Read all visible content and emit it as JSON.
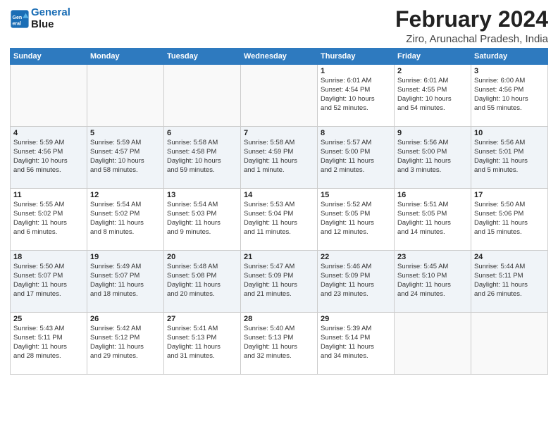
{
  "header": {
    "logo_line1": "General",
    "logo_line2": "Blue",
    "month_year": "February 2024",
    "location": "Ziro, Arunachal Pradesh, India"
  },
  "weekdays": [
    "Sunday",
    "Monday",
    "Tuesday",
    "Wednesday",
    "Thursday",
    "Friday",
    "Saturday"
  ],
  "weeks": [
    [
      {
        "day": "",
        "info": ""
      },
      {
        "day": "",
        "info": ""
      },
      {
        "day": "",
        "info": ""
      },
      {
        "day": "",
        "info": ""
      },
      {
        "day": "1",
        "info": "Sunrise: 6:01 AM\nSunset: 4:54 PM\nDaylight: 10 hours\nand 52 minutes."
      },
      {
        "day": "2",
        "info": "Sunrise: 6:01 AM\nSunset: 4:55 PM\nDaylight: 10 hours\nand 54 minutes."
      },
      {
        "day": "3",
        "info": "Sunrise: 6:00 AM\nSunset: 4:56 PM\nDaylight: 10 hours\nand 55 minutes."
      }
    ],
    [
      {
        "day": "4",
        "info": "Sunrise: 5:59 AM\nSunset: 4:56 PM\nDaylight: 10 hours\nand 56 minutes."
      },
      {
        "day": "5",
        "info": "Sunrise: 5:59 AM\nSunset: 4:57 PM\nDaylight: 10 hours\nand 58 minutes."
      },
      {
        "day": "6",
        "info": "Sunrise: 5:58 AM\nSunset: 4:58 PM\nDaylight: 10 hours\nand 59 minutes."
      },
      {
        "day": "7",
        "info": "Sunrise: 5:58 AM\nSunset: 4:59 PM\nDaylight: 11 hours\nand 1 minute."
      },
      {
        "day": "8",
        "info": "Sunrise: 5:57 AM\nSunset: 5:00 PM\nDaylight: 11 hours\nand 2 minutes."
      },
      {
        "day": "9",
        "info": "Sunrise: 5:56 AM\nSunset: 5:00 PM\nDaylight: 11 hours\nand 3 minutes."
      },
      {
        "day": "10",
        "info": "Sunrise: 5:56 AM\nSunset: 5:01 PM\nDaylight: 11 hours\nand 5 minutes."
      }
    ],
    [
      {
        "day": "11",
        "info": "Sunrise: 5:55 AM\nSunset: 5:02 PM\nDaylight: 11 hours\nand 6 minutes."
      },
      {
        "day": "12",
        "info": "Sunrise: 5:54 AM\nSunset: 5:02 PM\nDaylight: 11 hours\nand 8 minutes."
      },
      {
        "day": "13",
        "info": "Sunrise: 5:54 AM\nSunset: 5:03 PM\nDaylight: 11 hours\nand 9 minutes."
      },
      {
        "day": "14",
        "info": "Sunrise: 5:53 AM\nSunset: 5:04 PM\nDaylight: 11 hours\nand 11 minutes."
      },
      {
        "day": "15",
        "info": "Sunrise: 5:52 AM\nSunset: 5:05 PM\nDaylight: 11 hours\nand 12 minutes."
      },
      {
        "day": "16",
        "info": "Sunrise: 5:51 AM\nSunset: 5:05 PM\nDaylight: 11 hours\nand 14 minutes."
      },
      {
        "day": "17",
        "info": "Sunrise: 5:50 AM\nSunset: 5:06 PM\nDaylight: 11 hours\nand 15 minutes."
      }
    ],
    [
      {
        "day": "18",
        "info": "Sunrise: 5:50 AM\nSunset: 5:07 PM\nDaylight: 11 hours\nand 17 minutes."
      },
      {
        "day": "19",
        "info": "Sunrise: 5:49 AM\nSunset: 5:07 PM\nDaylight: 11 hours\nand 18 minutes."
      },
      {
        "day": "20",
        "info": "Sunrise: 5:48 AM\nSunset: 5:08 PM\nDaylight: 11 hours\nand 20 minutes."
      },
      {
        "day": "21",
        "info": "Sunrise: 5:47 AM\nSunset: 5:09 PM\nDaylight: 11 hours\nand 21 minutes."
      },
      {
        "day": "22",
        "info": "Sunrise: 5:46 AM\nSunset: 5:09 PM\nDaylight: 11 hours\nand 23 minutes."
      },
      {
        "day": "23",
        "info": "Sunrise: 5:45 AM\nSunset: 5:10 PM\nDaylight: 11 hours\nand 24 minutes."
      },
      {
        "day": "24",
        "info": "Sunrise: 5:44 AM\nSunset: 5:11 PM\nDaylight: 11 hours\nand 26 minutes."
      }
    ],
    [
      {
        "day": "25",
        "info": "Sunrise: 5:43 AM\nSunset: 5:11 PM\nDaylight: 11 hours\nand 28 minutes."
      },
      {
        "day": "26",
        "info": "Sunrise: 5:42 AM\nSunset: 5:12 PM\nDaylight: 11 hours\nand 29 minutes."
      },
      {
        "day": "27",
        "info": "Sunrise: 5:41 AM\nSunset: 5:13 PM\nDaylight: 11 hours\nand 31 minutes."
      },
      {
        "day": "28",
        "info": "Sunrise: 5:40 AM\nSunset: 5:13 PM\nDaylight: 11 hours\nand 32 minutes."
      },
      {
        "day": "29",
        "info": "Sunrise: 5:39 AM\nSunset: 5:14 PM\nDaylight: 11 hours\nand 34 minutes."
      },
      {
        "day": "",
        "info": ""
      },
      {
        "day": "",
        "info": ""
      }
    ]
  ]
}
